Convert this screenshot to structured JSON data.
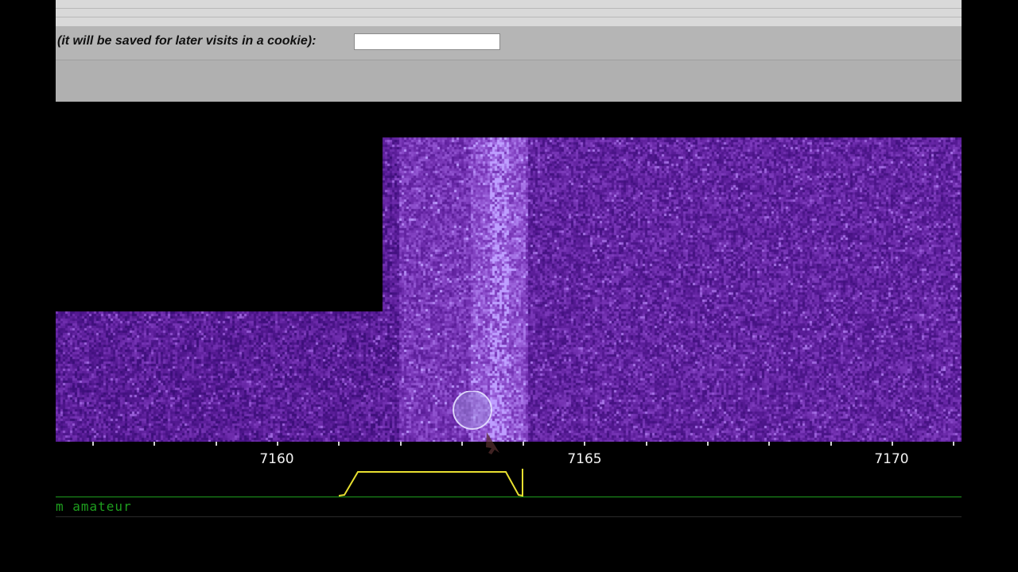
{
  "form": {
    "name_label": "(it will be saved for later visits in a cookie):",
    "name_value": ""
  },
  "frequency_scale": {
    "unit": "kHz",
    "labels": [
      "7160",
      "7165",
      "7170"
    ]
  },
  "passband": {
    "color": "#e8e030",
    "low_khz": 7161.2,
    "high_khz": 7163.9
  },
  "band": {
    "label": "m amateur",
    "color": "#1e9e1e"
  },
  "waterfall": {
    "palette": [
      "#0b0530",
      "#2a0e9c",
      "#5a1ed0",
      "#9a40f0",
      "#e4b8ff"
    ]
  },
  "colors": {
    "page_bg": "#000000",
    "topbar": "#d9d9d9",
    "form_row": "#b5b5b5",
    "tick_text": "#f2f2f2"
  }
}
